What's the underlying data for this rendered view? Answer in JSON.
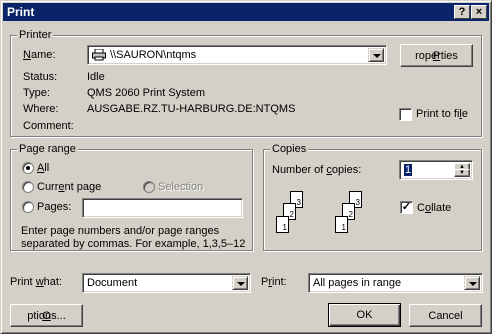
{
  "window": {
    "title": "Print",
    "help_label": "?",
    "close_label": "×"
  },
  "printer": {
    "group_label": "Printer",
    "name_label_pre": "",
    "name_label_u": "N",
    "name_label_post": "ame:",
    "name_value": "\\\\SAURON\\ntqms",
    "properties_label_pre": "",
    "properties_label_u": "P",
    "properties_label_post": "roperties",
    "status_label": "Status:",
    "status_value": "Idle",
    "type_label": "Type:",
    "type_value": "QMS 2060 Print System",
    "where_label": "Where:",
    "where_value": "AUSGABE.RZ.TU-HARBURG.DE:NTQMS",
    "comment_label": "Comment:",
    "comment_value": "",
    "print_to_file_pre": "Print to fi",
    "print_to_file_u": "l",
    "print_to_file_post": "e"
  },
  "page_range": {
    "group_label": "Page range",
    "all_pre": "",
    "all_u": "A",
    "all_post": "ll",
    "current_pre": "Curr",
    "current_u": "e",
    "current_post": "nt page",
    "selection_label": "Selection",
    "pages_pre": "Pa",
    "pages_u": "g",
    "pages_post": "es:",
    "pages_value": "",
    "hint_line1": "Enter page numbers and/or page ranges",
    "hint_line2": "separated by commas.  For example, 1,3,5–12"
  },
  "copies": {
    "group_label": "Copies",
    "number_pre": "Number of ",
    "number_u": "c",
    "number_post": "opies:",
    "number_value": "1",
    "collate_pre": "C",
    "collate_u": "o",
    "collate_post": "llate",
    "collate_checked": true,
    "page_numbers": [
      "1",
      "2",
      "3"
    ]
  },
  "footer": {
    "print_what_pre": "Print ",
    "print_what_u": "w",
    "print_what_post": "hat:",
    "print_what_value": "Document",
    "print_pre": "P",
    "print_u": "r",
    "print_post": "int:",
    "print_value": "All pages in range",
    "options_pre": "",
    "options_u": "O",
    "options_post": "ptions...",
    "ok_label": "OK",
    "cancel_label": "Cancel"
  },
  "icons": [
    "printer-icon",
    "help-icon",
    "close-icon",
    "dropdown-arrow-icon",
    "spin-up-icon",
    "spin-down-icon",
    "collate-pages-icon"
  ]
}
